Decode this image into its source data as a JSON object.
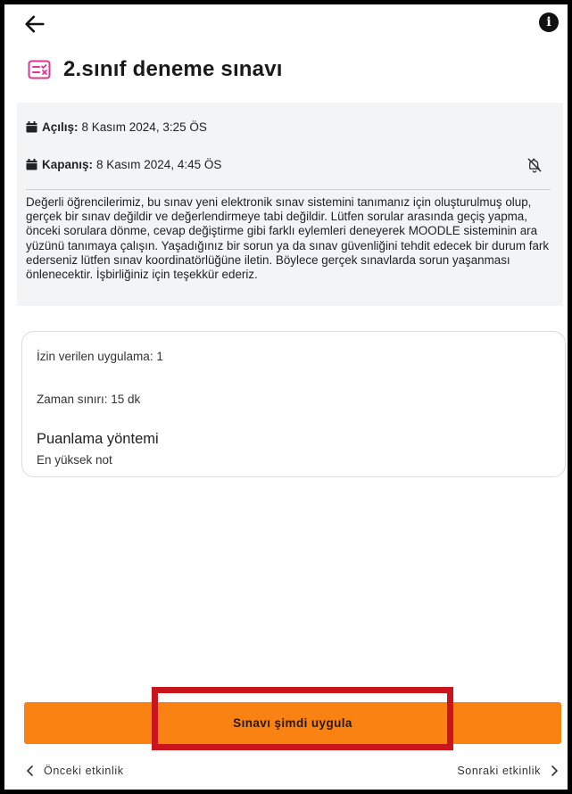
{
  "header": {
    "title": "2.sınıf deneme sınavı"
  },
  "dates": {
    "open_label": "Açılış:",
    "open_value": "8 Kasım 2024, 3:25 ÖS",
    "close_label": "Kapanış:",
    "close_value": "8 Kasım 2024, 4:45 ÖS"
  },
  "description": "Değerli öğrencilerimiz, bu sınav yeni elektronik sınav sistemini tanımanız için oluşturulmuş olup, gerçek bir sınav değildir ve değerlendirmeye tabi değildir. Lütfen sorular arasında geçiş yapma, önceki sorulara dönme, cevap değiştirme gibi farklı eylemleri deneyerek MOODLE sisteminin ara yüzünü tanımaya çalışın. Yaşadığınız bir sorun ya da sınav güvenliğini tehdit edecek bir durum fark ederseniz lütfen sınav koordinatörlüğüne iletin. Böylece gerçek sınavlarda sorun yaşanması önlenecektir. İşbirliğiniz için teşekkür ederiz.",
  "quiz_info": {
    "attempts_allowed": "İzin verilen uygulama: 1",
    "time_limit": "Zaman sınırı: 15 dk",
    "grading_method_label": "Puanlama yöntemi",
    "grading_method_value": "En yüksek not"
  },
  "actions": {
    "start_label": "Sınavı şimdi uygula"
  },
  "navigation": {
    "previous_label": "Önceki etkinlik",
    "next_label": "Sonraki etkinlik"
  },
  "colors": {
    "accent": "#f98212",
    "highlight_border": "#c8161c",
    "quiz_icon": "#e0348f",
    "panel_bg": "#f3f4f6"
  },
  "icons": {
    "back": "arrow-left-icon",
    "info": "info-icon",
    "quiz": "quiz-icon",
    "calendar": "calendar-icon",
    "notifications_off": "bell-off-icon",
    "prev": "chevron-left-icon",
    "next": "chevron-right-icon"
  }
}
